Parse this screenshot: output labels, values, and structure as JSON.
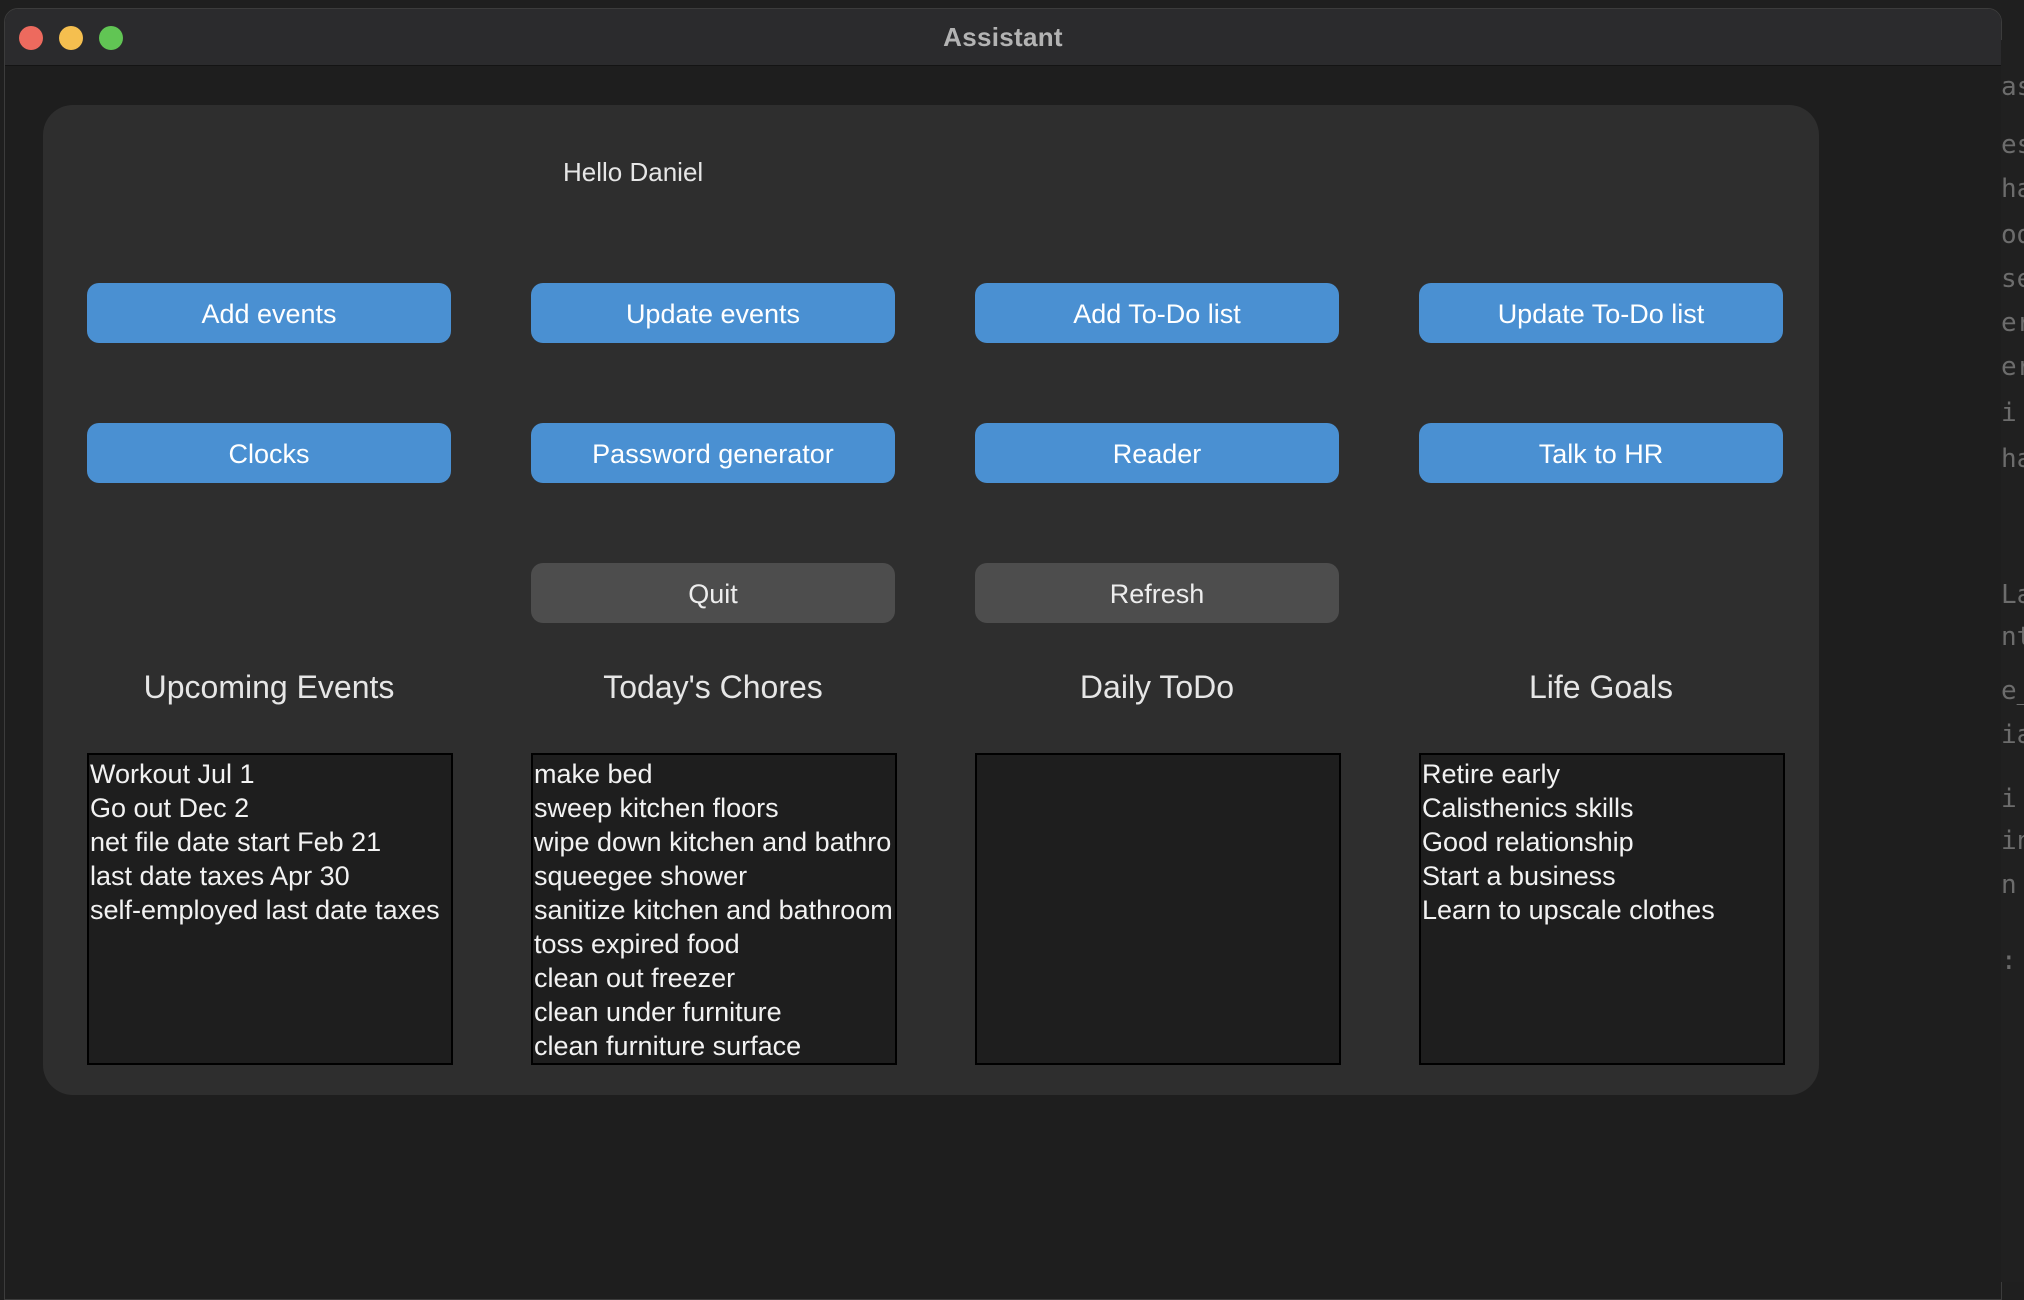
{
  "window": {
    "title": "Assistant"
  },
  "greeting": "Hello Daniel",
  "buttons": {
    "add_events": "Add events",
    "update_events": "Update events",
    "add_todo": "Add To-Do list",
    "update_todo": "Update To-Do list",
    "clocks": "Clocks",
    "password_generator": "Password generator",
    "reader": "Reader",
    "talk_to_hr": "Talk to HR",
    "quit": "Quit",
    "refresh": "Refresh"
  },
  "sections": {
    "upcoming_events": {
      "title": "Upcoming Events",
      "items": [
        "Workout Jul 1",
        "Go out Dec 2",
        "net file date start Feb 21",
        "last date taxes Apr 30",
        "self-employed last date taxes"
      ]
    },
    "todays_chores": {
      "title": "Today's Chores",
      "items": [
        "make bed",
        "sweep kitchen floors",
        "wipe down kitchen and bathro",
        "squeegee shower",
        "sanitize kitchen and bathroom",
        "toss expired food",
        "clean out freezer",
        "clean under furniture",
        "clean furniture surface"
      ]
    },
    "daily_todo": {
      "title": "Daily ToDo",
      "items": []
    },
    "life_goals": {
      "title": "Life Goals",
      "items": [
        "Retire early",
        "Calisthenics skills",
        "Good relationship",
        "Start a business",
        "Learn to upscale clothes"
      ]
    }
  },
  "background_editor_fragments": [
    "as",
    "es",
    "ha",
    "od",
    "se",
    "er",
    "er",
    "i",
    "ha",
    "La",
    "nt",
    "e_",
    "ia",
    "i",
    "in",
    "n",
    ":"
  ],
  "colors": {
    "primary_button": "#4a90d2",
    "secondary_button": "#4d4d4d",
    "panel": "#2e2e2e",
    "window_bg": "#1e1e1e"
  }
}
